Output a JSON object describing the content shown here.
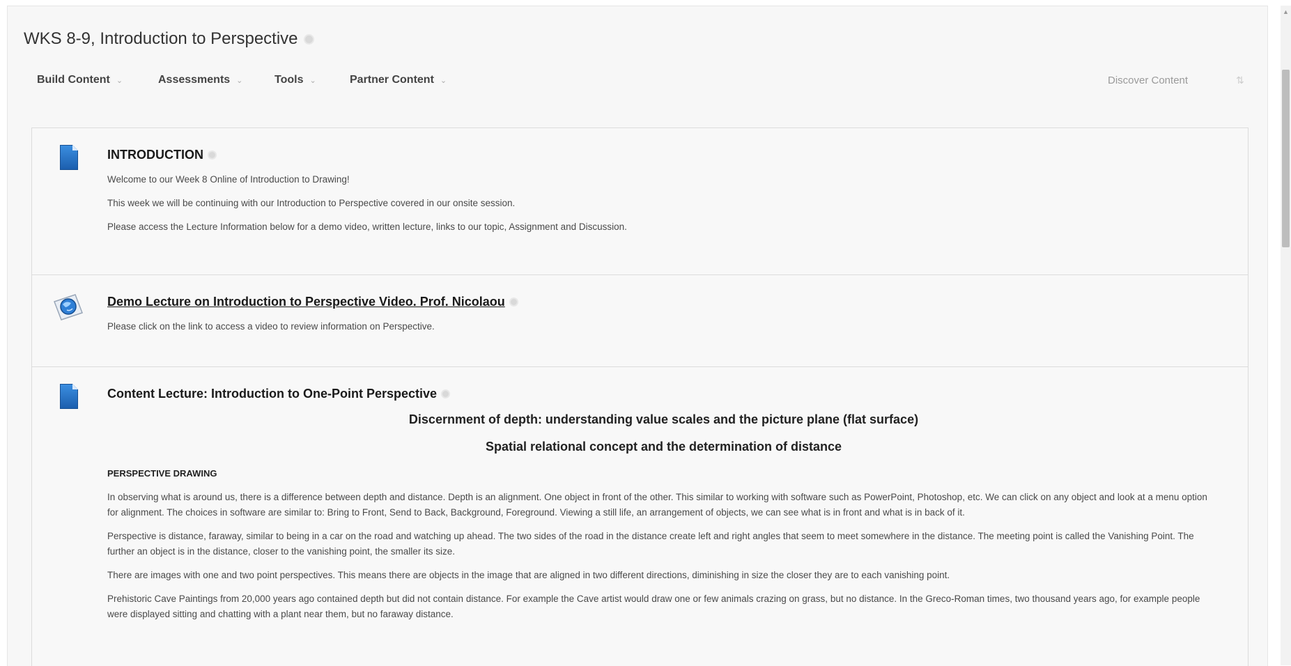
{
  "page": {
    "title": "WKS 8-9, Introduction to Perspective"
  },
  "action_bar": {
    "items": [
      {
        "label": "Build Content"
      },
      {
        "label": "Assessments"
      },
      {
        "label": "Tools"
      },
      {
        "label": "Partner Content"
      }
    ],
    "discover": "Discover Content",
    "chevron": "⌄"
  },
  "items": [
    {
      "title": "INTRODUCTION",
      "icon": "document-icon",
      "paragraphs": [
        "Welcome to our Week 8 Online of Introduction to Drawing!",
        "This week we will be continuing with our Introduction to Perspective covered in our onsite session.",
        "Please access the Lecture Information below for a demo video, written lecture, links to our topic, Assignment and Discussion."
      ]
    },
    {
      "title": "Demo Lecture on Introduction to Perspective Video. Prof. Nicolaou",
      "icon": "web-link-icon",
      "paragraphs": [
        "Please click on the link to access a video to review information on Perspective."
      ]
    },
    {
      "title": "Content Lecture: Introduction to One-Point Perspective",
      "icon": "document-icon",
      "heading1": "Discernment of depth: understanding value scales and the picture plane (flat surface)",
      "heading2": "Spatial relational concept and the determination of distance",
      "section_heading": "PERSPECTIVE DRAWING",
      "paragraphs": [
        "In observing what is around us, there is a difference between depth and distance.  Depth is an alignment.  One object in front of the other.  This similar to working with software such as PowerPoint, Photoshop, etc.  We can click on any object and look at a menu option for alignment.  The choices in software are similar to:  Bring to Front, Send to Back, Background, Foreground.  Viewing a still life, an arrangement of objects, we can see what is in front and what is in back of it.",
        "Perspective is distance, faraway, similar to being in a car on the road and watching up ahead.   The two sides of the road in the distance create left and right angles that seem to meet somewhere in the distance.  The meeting point is called the Vanishing Point.    The further an object is in the distance, closer to the vanishing point, the smaller its size.",
        "There are images with one and two point perspectives.  This means there are objects in the image that are aligned in two different directions, diminishing in size the closer they are to each vanishing point.",
        "Prehistoric Cave Paintings from 20,000 years ago contained depth but did not contain distance.  For example the Cave artist would draw one or few animals crazing on grass, but no distance.  In the Greco-Roman times, two thousand years ago, for example people were displayed sitting and chatting with a plant near them, but no faraway distance."
      ]
    }
  ],
  "colors": {
    "icon_blue": "#1f66b8",
    "panel_bg": "#f8f8f8",
    "border": "#dcdcdc"
  }
}
